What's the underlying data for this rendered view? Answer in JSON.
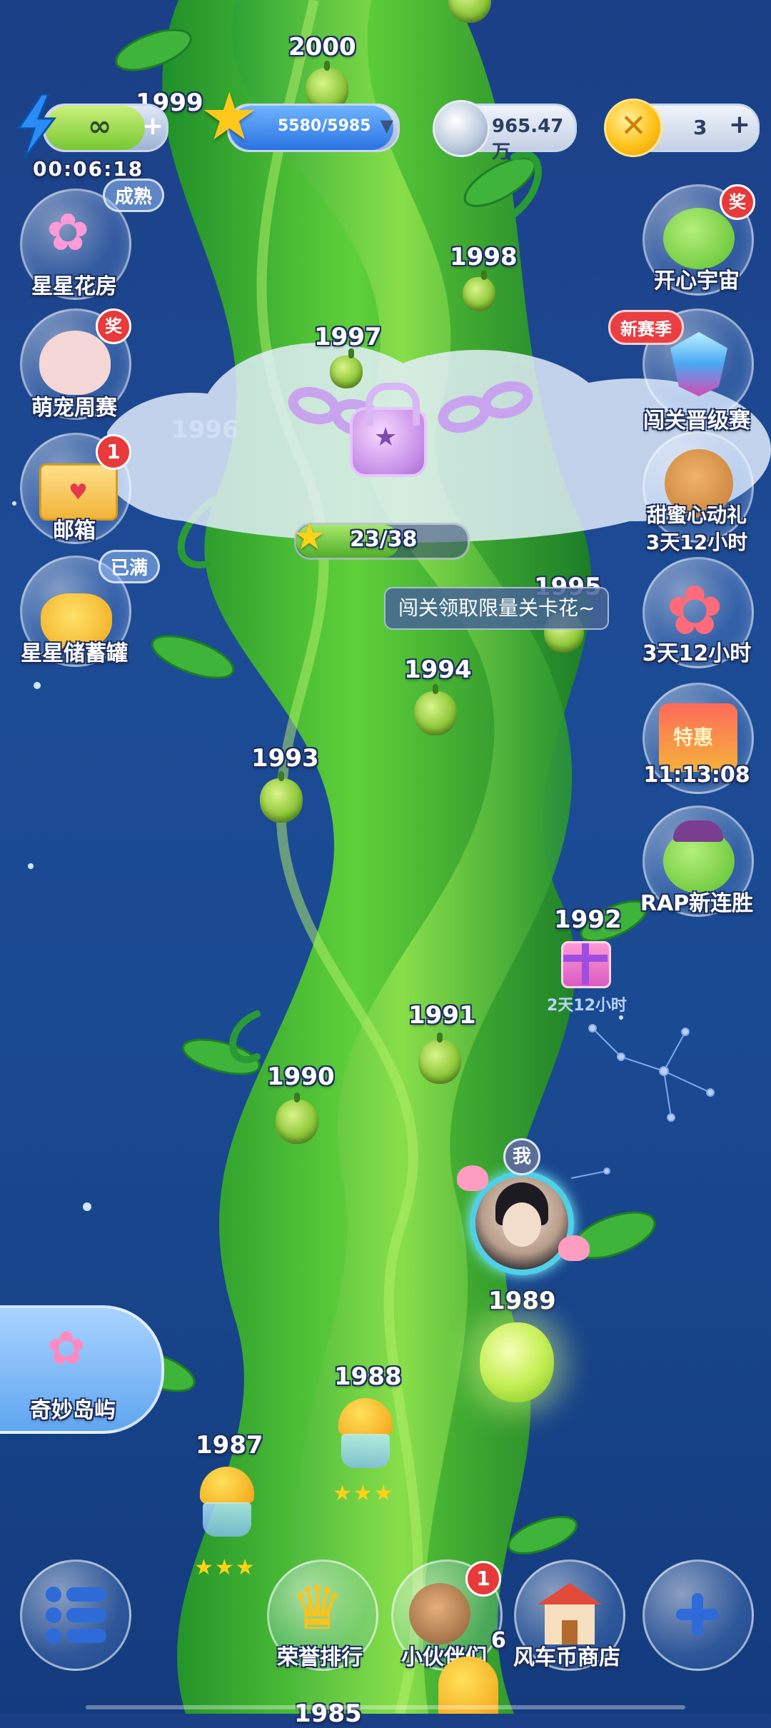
{
  "status": {
    "energy_value": "∞",
    "energy_timer": "00:06:18",
    "stars_value": "5580/5985",
    "silver_value": "965.47万",
    "gold_value": "3"
  },
  "levels": {
    "l2000": "2000",
    "l1999": "1999",
    "l1998": "1998",
    "l1997": "1997",
    "l1996": "1996",
    "l1995": "1995",
    "l1994": "1994",
    "l1993": "1993",
    "l1992": "1992",
    "l1991": "1991",
    "l1990": "1990",
    "l1989": "1989",
    "l1988": "1988",
    "l1987": "1987",
    "l1985": "1985"
  },
  "lock": {
    "progress_text": "23/38",
    "progress_fraction": 0.605
  },
  "gift_1992_timer": "2天12小时",
  "tooltip": "闯关领取限量关卡花~",
  "player_badge": "我",
  "left_menu": [
    {
      "label": "星星花房",
      "tag": "成熟"
    },
    {
      "label": "萌宠周赛",
      "tag": "奖"
    },
    {
      "label": "邮箱",
      "badge": "1"
    },
    {
      "label": "星星储蓄罐",
      "tag": "已满"
    }
  ],
  "island": {
    "label": "奇妙岛屿"
  },
  "right_menu": [
    {
      "label": "开心宇宙",
      "tag": "奖"
    },
    {
      "label": "闯关晋级赛",
      "tag": "新赛季"
    },
    {
      "label": "甜蜜心动礼",
      "sub": "3天12小时"
    },
    {
      "label": "3天12小时"
    },
    {
      "label": "11:13:08",
      "inner": "特惠"
    },
    {
      "label": "RAP新连胜"
    }
  ],
  "bottom_nav": {
    "ranking": "荣誉排行",
    "partners": "小伙伴们",
    "partners_badge": "1",
    "partners_count": "6",
    "shop": "风车币商店"
  },
  "stars": {
    "l1988": "★★★",
    "l1987": "★★★"
  },
  "colors": {
    "accent_green": "#7ec93a",
    "energy_blue": "#1e7ff0",
    "badge_red": "#e8393b"
  }
}
